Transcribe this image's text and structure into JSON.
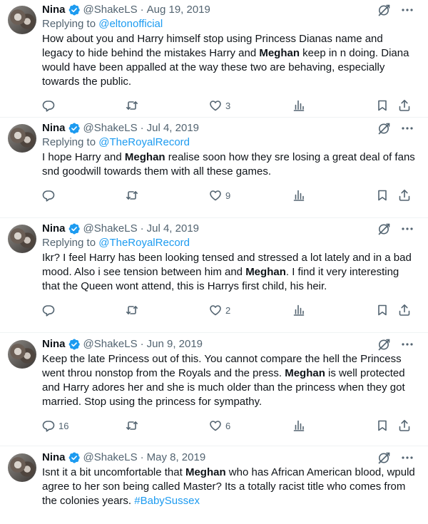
{
  "tweets": [
    {
      "name": "Nina",
      "handle": "@ShakeLS",
      "date": "Aug 19, 2019",
      "replying_label": "Replying to",
      "replying_to": "@eltonofficial",
      "segments": [
        {
          "t": "How about you and Harry himself stop using Princess Dianas name and legacy to hide behind the mistakes Harry and "
        },
        {
          "t": "Meghan",
          "b": true
        },
        {
          "t": " keep in n doing. Diana would have been appalled at the way these two are behaving, especially towards the public."
        }
      ],
      "replies": "",
      "retweets": "",
      "likes": "3"
    },
    {
      "name": "Nina",
      "handle": "@ShakeLS",
      "date": "Jul 4, 2019",
      "replying_label": "Replying to",
      "replying_to": "@TheRoyalRecord",
      "segments": [
        {
          "t": "I hope Harry and "
        },
        {
          "t": "Meghan",
          "b": true
        },
        {
          "t": " realise soon how they sre losing a great deal of fans snd goodwill towards them with all these games."
        }
      ],
      "replies": "",
      "retweets": "",
      "likes": "9"
    },
    {
      "name": "Nina",
      "handle": "@ShakeLS",
      "date": "Jul 4, 2019",
      "replying_label": "Replying to",
      "replying_to": "@TheRoyalRecord",
      "segments": [
        {
          "t": "Ikr? I feel Harry has been looking tensed and stressed a lot lately and in a bad mood. Also i see tension between him and "
        },
        {
          "t": "Meghan",
          "b": true
        },
        {
          "t": ". I find it very interesting that the Queen wont attend, this is Harrys first child, his heir."
        }
      ],
      "replies": "",
      "retweets": "",
      "likes": "2"
    },
    {
      "name": "Nina",
      "handle": "@ShakeLS",
      "date": "Jun 9, 2019",
      "replying_label": "",
      "replying_to": "",
      "segments": [
        {
          "t": "Keep the late Princess out of this. You cannot compare the hell the Princess went throu nonstop from the Royals and the press. "
        },
        {
          "t": "Meghan",
          "b": true
        },
        {
          "t": " is well protected and Harry adores her and she is much older than the princess when they got married. Stop using the princess for sympathy."
        }
      ],
      "replies": "16",
      "retweets": "",
      "likes": "6"
    },
    {
      "name": "Nina",
      "handle": "@ShakeLS",
      "date": "May 8, 2019",
      "replying_label": "",
      "replying_to": "",
      "segments": [
        {
          "t": "Isnt it a bit uncomfortable that "
        },
        {
          "t": "Meghan",
          "b": true
        },
        {
          "t": " who has African American blood, wpuld agree to her son being called Master? Its a totally racist title who comes from the colonies years. "
        },
        {
          "t": "#BabySussex",
          "h": true
        }
      ],
      "replies": "",
      "retweets": "",
      "likes": ""
    }
  ],
  "colors": {
    "accent": "#1d9bf0",
    "muted": "#536471",
    "text": "#0f1419",
    "divider": "#eff3f4"
  },
  "icons": [
    "verified-badge-icon",
    "grok-icon",
    "more-icon",
    "reply-icon",
    "retweet-icon",
    "like-icon",
    "views-icon",
    "bookmark-icon",
    "share-icon"
  ]
}
